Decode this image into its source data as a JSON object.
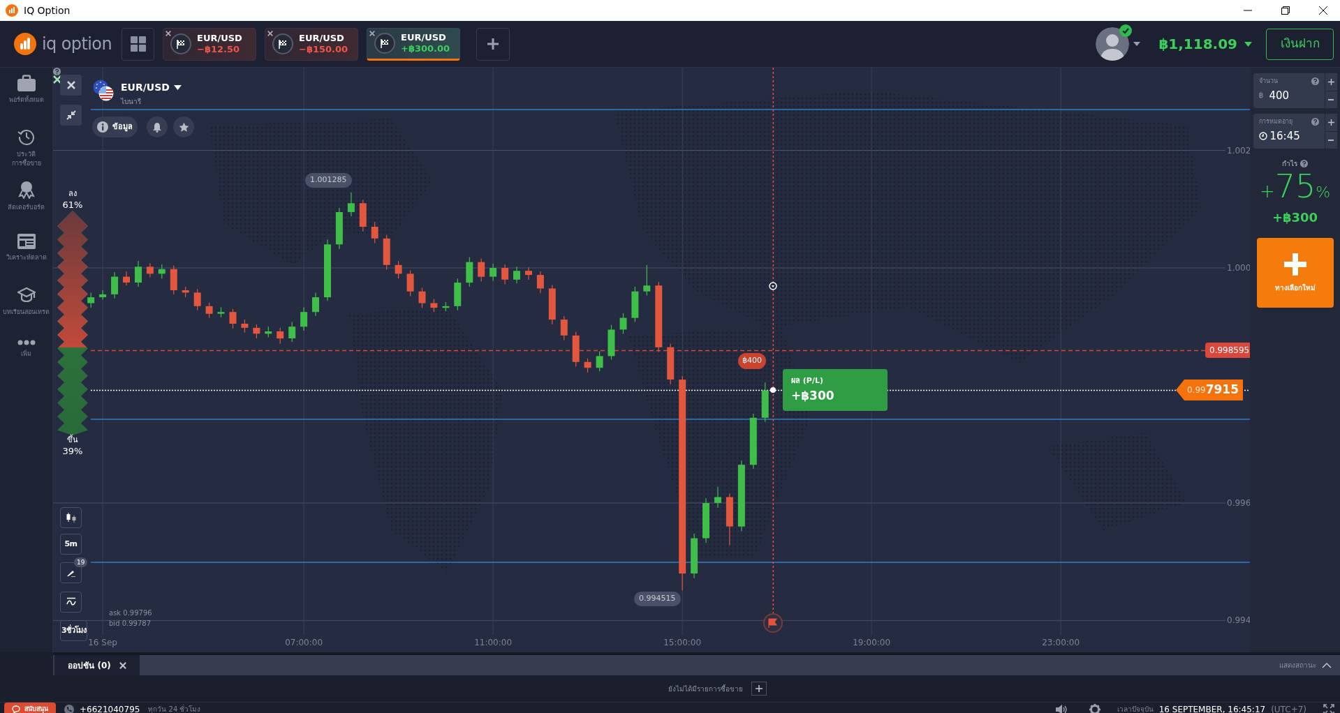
{
  "window": {
    "title": "IQ Option"
  },
  "header": {
    "logo": "iq option",
    "asset_tabs": [
      {
        "pair": "EUR/USD",
        "result": "−฿12.50",
        "kind": "loss",
        "selected": false
      },
      {
        "pair": "EUR/USD",
        "result": "−฿150.00",
        "kind": "loss",
        "selected": false
      },
      {
        "pair": "EUR/USD",
        "result": "+฿300.00",
        "kind": "profit",
        "selected": true
      }
    ],
    "avatar_verified": true,
    "balance": "฿1,118.09",
    "deposit_button": "เงินฝาก"
  },
  "sidebar": {
    "items": [
      {
        "kind": "briefcase",
        "lines": [
          "พอร์ตทั้งหมด"
        ]
      },
      {
        "kind": "history",
        "lines": [
          "ประวัติ",
          "การซื้อขาย"
        ]
      },
      {
        "kind": "medal",
        "lines": [
          "ลีดเดอร์บอร์ด"
        ]
      },
      {
        "kind": "news",
        "lines": [
          "วิเคราะห์ตลาด"
        ]
      },
      {
        "kind": "cap",
        "lines": [
          "บทเรียนสอนเทรด"
        ]
      },
      {
        "kind": "more",
        "lines": [
          "เพิ่ม"
        ]
      }
    ]
  },
  "chart": {
    "asset": "EUR/USD",
    "asset_type": "ไบนารี",
    "info_button": "ข้อมูล",
    "sentiment": {
      "down_label": "ลง",
      "down_percent": "61%",
      "up_label": "ขึ้น",
      "up_percent": "39%",
      "level": 0.61
    },
    "high_label": "1.001285",
    "low_label": "0.994515",
    "chart_data": {
      "type": "candlestick",
      "xlim": [
        1.7,
        26.48
      ],
      "ylim": [
        0.993756,
        1.003407
      ],
      "grid": true,
      "ref_lines": [
        {
          "axis": "y",
          "value": 1.002694,
          "color": "#2f7fc1"
        },
        {
          "axis": "y",
          "value": 0.997424,
          "color": "#2f7fc1"
        },
        {
          "axis": "y",
          "value": 0.994991,
          "color": "#2f7fc1"
        },
        {
          "axis": "y",
          "value": 0.998595,
          "color": "#d9483b"
        },
        {
          "axis": "y",
          "value": 0.997915,
          "color": "#ffffff"
        },
        {
          "axis": "x",
          "value": 16.92,
          "color": "#e8503c"
        }
      ],
      "xticks": [
        {
          "value": 2.75,
          "label": "16 Sep"
        },
        {
          "value": 7,
          "label": "07:00:00"
        },
        {
          "value": 11,
          "label": "11:00:00"
        },
        {
          "value": 15,
          "label": "15:00:00"
        },
        {
          "value": 19,
          "label": "19:00:00"
        },
        {
          "value": 23,
          "label": "23:00:00"
        }
      ],
      "yticks": [
        {
          "value": 1.002,
          "label": "1.002"
        },
        {
          "value": 1.0,
          "label": "1.000"
        },
        {
          "value": 0.996,
          "label": "0.996"
        },
        {
          "value": 0.994,
          "label": "0.994"
        }
      ],
      "x": [
        2.5,
        2.75,
        3,
        3.25,
        3.5,
        3.75,
        4,
        4.25,
        4.5,
        4.75,
        5,
        5.25,
        5.5,
        5.75,
        6,
        6.25,
        6.5,
        6.75,
        7,
        7.25,
        7.5,
        7.75,
        8,
        8.25,
        8.5,
        8.75,
        9,
        9.25,
        9.5,
        9.75,
        10,
        10.25,
        10.5,
        10.75,
        11,
        11.25,
        11.5,
        11.75,
        12,
        12.25,
        12.5,
        12.75,
        13,
        13.25,
        13.5,
        13.75,
        14,
        14.25,
        14.5,
        14.75,
        15,
        15.25,
        15.5,
        15.75,
        16,
        16.25,
        16.5,
        16.75
      ],
      "ohlc": [
        [
          0.9994,
          0.99958,
          0.99932,
          0.9995
        ],
        [
          0.9995,
          0.99962,
          0.99946,
          0.99955
        ],
        [
          0.99955,
          0.99993,
          0.99948,
          0.99985
        ],
        [
          0.99985,
          0.99994,
          0.9997,
          0.99975
        ],
        [
          0.99975,
          1.00012,
          0.99968,
          1.00002
        ],
        [
          1.00002,
          1.00008,
          0.99984,
          0.9999
        ],
        [
          0.9999,
          1.00006,
          0.99982,
          0.99998
        ],
        [
          0.99998,
          1.00004,
          0.99955,
          0.99962
        ],
        [
          0.99962,
          0.99968,
          0.9995,
          0.99958
        ],
        [
          0.99958,
          0.99964,
          0.99928,
          0.99935
        ],
        [
          0.99935,
          0.99941,
          0.99915,
          0.99922
        ],
        [
          0.99922,
          0.99933,
          0.99916,
          0.99925
        ],
        [
          0.99925,
          0.9993,
          0.99897,
          0.99905
        ],
        [
          0.99905,
          0.99912,
          0.9989,
          0.99898
        ],
        [
          0.99898,
          0.99904,
          0.9988,
          0.99888
        ],
        [
          0.99888,
          0.999,
          0.99882,
          0.99892
        ],
        [
          0.99892,
          0.99898,
          0.99871,
          0.9988
        ],
        [
          0.9988,
          0.99908,
          0.99874,
          0.999
        ],
        [
          0.999,
          0.99933,
          0.99893,
          0.99925
        ],
        [
          0.99925,
          0.99958,
          0.99918,
          0.9995
        ],
        [
          0.9995,
          1.00048,
          0.99944,
          1.0004
        ],
        [
          1.0004,
          1.00102,
          1.00032,
          1.00095
        ],
        [
          1.00095,
          1.001285,
          1.00088,
          1.0011
        ],
        [
          1.0011,
          1.00116,
          1.00062,
          1.0007
        ],
        [
          1.0007,
          1.00078,
          1.00042,
          1.0005
        ],
        [
          1.0005,
          1.00056,
          0.99997,
          1.00005
        ],
        [
          1.00005,
          1.00012,
          0.99982,
          0.9999
        ],
        [
          0.9999,
          0.99996,
          0.99952,
          0.9996
        ],
        [
          0.9996,
          0.99966,
          0.99932,
          0.9994
        ],
        [
          0.9994,
          0.99947,
          0.99925,
          0.99932
        ],
        [
          0.99932,
          0.99942,
          0.99926,
          0.99935
        ],
        [
          0.99935,
          0.99982,
          0.99928,
          0.99975
        ],
        [
          0.99975,
          1.00018,
          0.99968,
          1.0001
        ],
        [
          1.0001,
          1.00016,
          0.99977,
          0.99985
        ],
        [
          0.99985,
          1.00007,
          0.99978,
          1.0
        ],
        [
          1.0,
          1.00006,
          0.99972,
          0.9998
        ],
        [
          0.9998,
          1.00002,
          0.99974,
          0.99995
        ],
        [
          0.99995,
          1.00001,
          0.9998,
          0.99988
        ],
        [
          0.99988,
          0.99994,
          0.99957,
          0.99965
        ],
        [
          0.99965,
          0.99971,
          0.99904,
          0.99912
        ],
        [
          0.99912,
          0.99918,
          0.99877,
          0.99885
        ],
        [
          0.99885,
          0.99891,
          0.99832,
          0.9984
        ],
        [
          0.9984,
          0.99846,
          0.99822,
          0.9983
        ],
        [
          0.9983,
          0.99858,
          0.99824,
          0.9985
        ],
        [
          0.9985,
          0.99903,
          0.99844,
          0.99895
        ],
        [
          0.99895,
          0.99923,
          0.99888,
          0.99915
        ],
        [
          0.99915,
          0.99968,
          0.99908,
          0.9996
        ],
        [
          0.9996,
          1.00005,
          0.99953,
          0.9997
        ],
        [
          0.9997,
          0.99976,
          0.99857,
          0.99865
        ],
        [
          0.99865,
          0.99871,
          0.99802,
          0.9981
        ],
        [
          0.9981,
          0.99816,
          0.994515,
          0.9948
        ],
        [
          0.9948,
          0.99548,
          0.99472,
          0.9954
        ],
        [
          0.9954,
          0.99608,
          0.99532,
          0.996
        ],
        [
          0.996,
          0.99628,
          0.99592,
          0.9961
        ],
        [
          0.9961,
          0.99616,
          0.99528,
          0.9956
        ],
        [
          0.9956,
          0.99672,
          0.99552,
          0.99665
        ],
        [
          0.99665,
          0.99752,
          0.99658,
          0.99745
        ],
        [
          0.99745,
          0.99805,
          0.99738,
          0.997915
        ]
      ]
    },
    "strike_price": "0.998595",
    "investment_marker": "฿400",
    "current_price": {
      "prefix": "0.99",
      "main": "7915"
    },
    "pl_card": {
      "label": "ผล (P/L)",
      "value": "+฿300"
    },
    "tools": [
      {
        "kind": "candles"
      },
      {
        "kind": "text",
        "label": "5m"
      },
      {
        "kind": "draw",
        "badge": "19"
      },
      {
        "kind": "indicator"
      },
      {
        "kind": "text",
        "label": "3ชั่วโมง"
      }
    ],
    "quote": {
      "ask": "ask 0.99796",
      "bid": "bid 0.99787"
    }
  },
  "trade_panel": {
    "amount_label": "จำนวน",
    "currency": "฿",
    "amount": "400",
    "expiry_label": "การหมดอายุ",
    "expiry": "16:45",
    "profit_label": "กำไร",
    "profit_percent": {
      "sign": "+",
      "number": "75",
      "unit": "%"
    },
    "profit_amount": "+฿300",
    "new_option_button": "ทางเลือกใหม่"
  },
  "positions_panel": {
    "tab": "ออปชัน (0)",
    "show_status": "แสดงสถานะ",
    "empty_text": "ยังไม่ได้มีรายการซื้อขาย"
  },
  "status_bar": {
    "support_button": "สนับสนุน",
    "phone": "+6621040795",
    "hours": "ทุกวัน 24 ชั่วโมง",
    "time_label": "เวลาปัจจุบัน",
    "time": "16 SEPTEMBER, 16:45:17",
    "timezone": "(UTC+7)"
  }
}
